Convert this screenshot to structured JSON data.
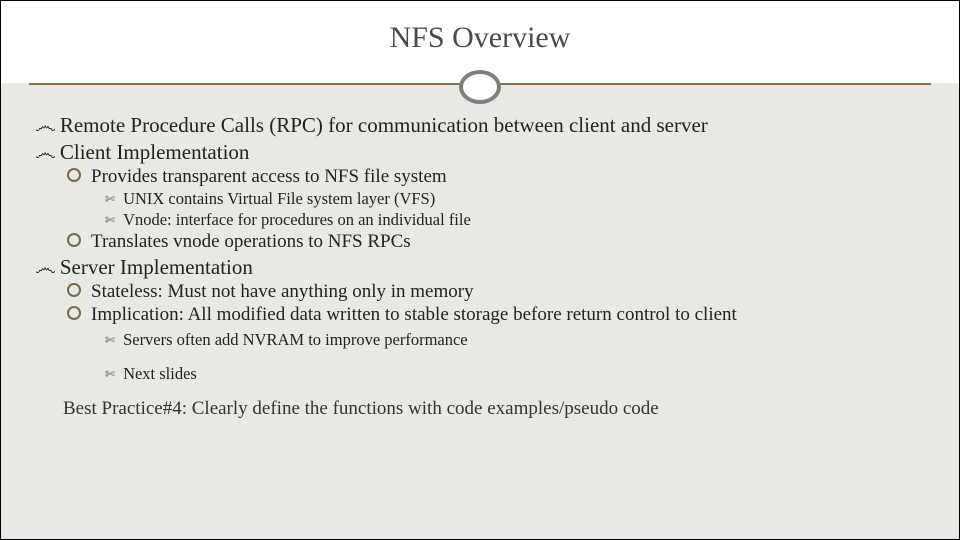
{
  "title": "NFS Overview",
  "bullets": {
    "l1_rpc": "Remote Procedure Calls (RPC) for communication between client and server",
    "l1_client": "Client Implementation",
    "l2_provides": "Provides transparent access to NFS file system",
    "l3_unix": "UNIX contains Virtual File system layer (VFS)",
    "l3_vnode": "Vnode: interface for procedures on an individual file",
    "l2_translates": "Translates vnode operations to NFS RPCs",
    "l1_server": "Server Implementation",
    "l2_stateless": "Stateless: Must not have anything only in memory",
    "l2_implication": "Implication: All modified data written to stable storage before return control to client",
    "l3_nvram": "Servers often add NVRAM to improve performance",
    "l3_next": "Next slides"
  },
  "best_practice": "Best Practice#4: Clearly define the functions with code examples/pseudo code"
}
